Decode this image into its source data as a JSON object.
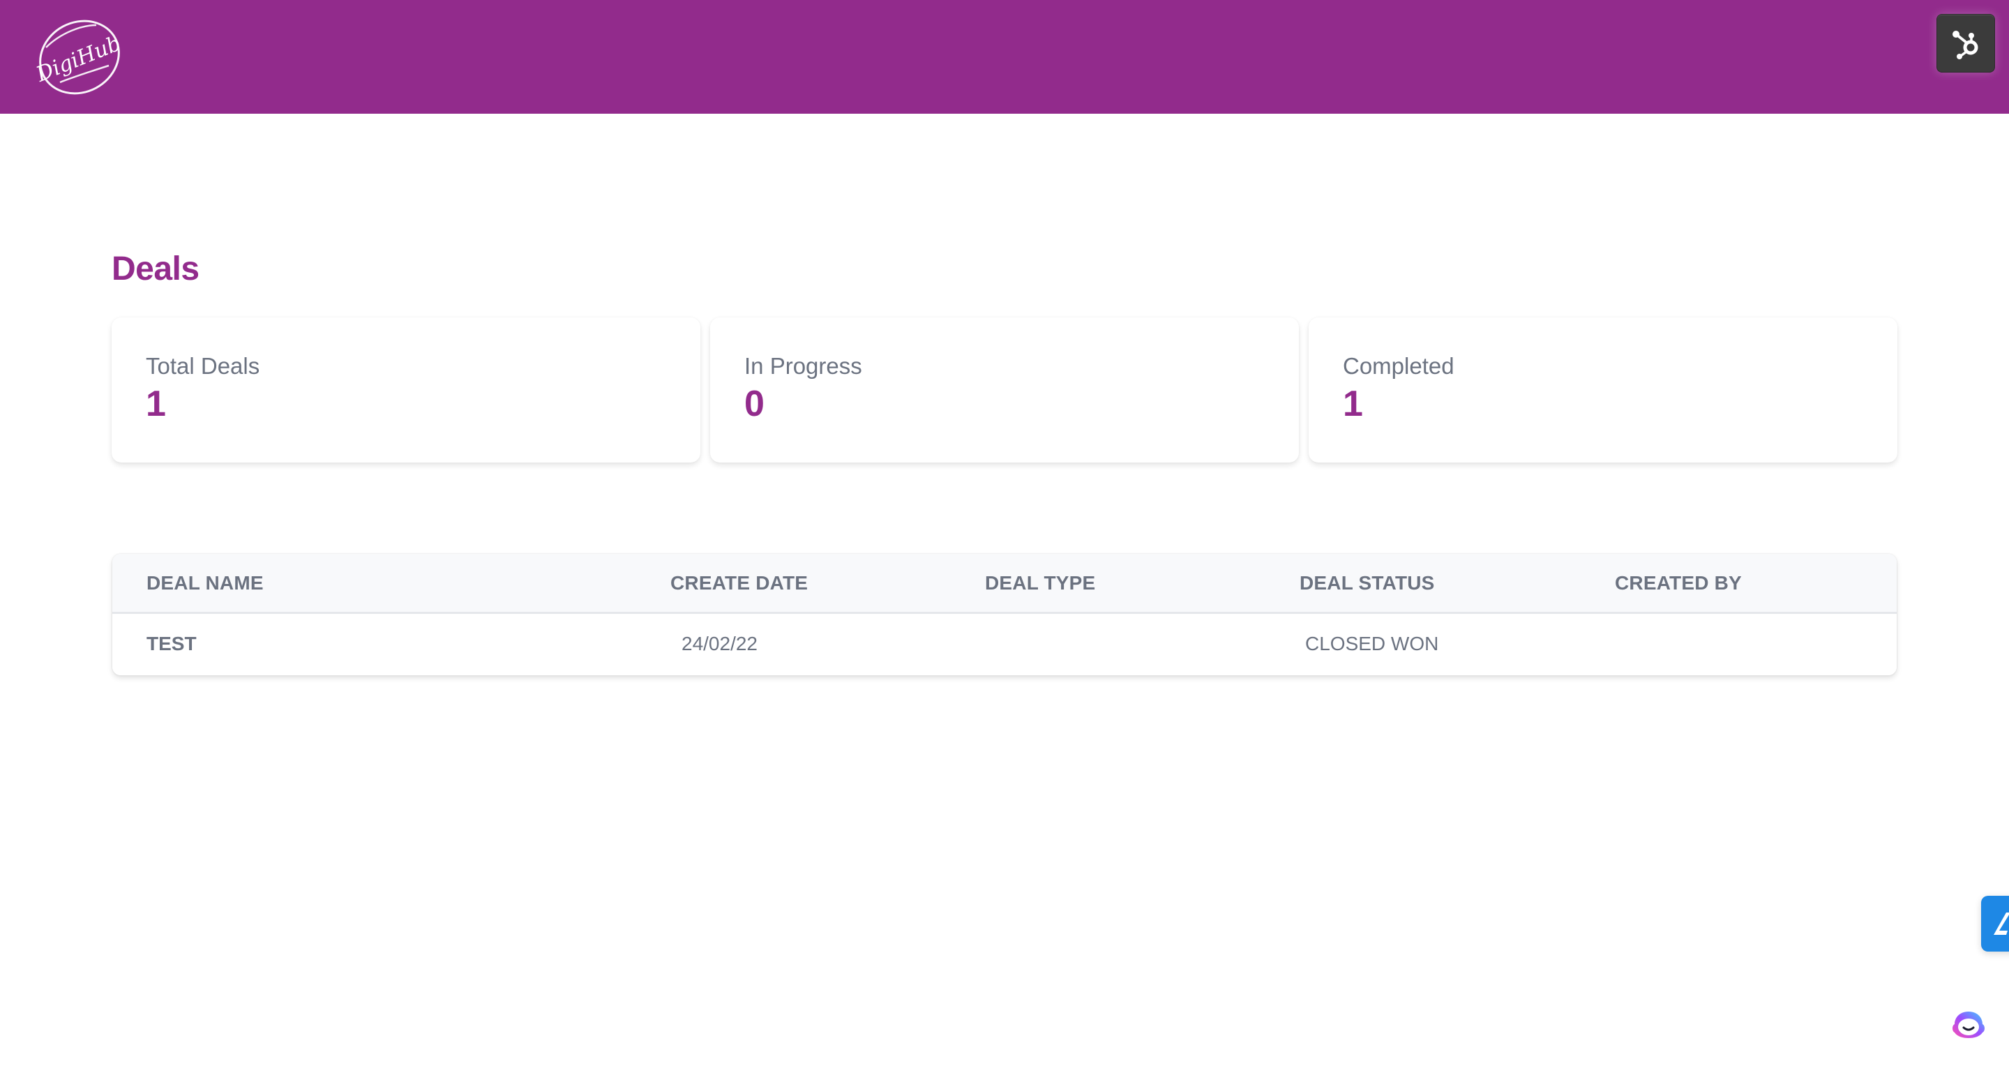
{
  "header": {
    "logo_text": "DigiHub",
    "brand_color": "#922b8c",
    "hubspot_icon": "hubspot-sprocket-icon"
  },
  "page": {
    "title": "Deals"
  },
  "stats": [
    {
      "label": "Total Deals",
      "value": "1"
    },
    {
      "label": "In Progress",
      "value": "0"
    },
    {
      "label": "Completed",
      "value": "1"
    }
  ],
  "table": {
    "columns": [
      "DEAL NAME",
      "CREATE DATE",
      "DEAL TYPE",
      "DEAL STATUS",
      "CREATED BY"
    ],
    "rows": [
      {
        "deal_name": "TEST",
        "create_date": "24/02/22",
        "deal_type": "",
        "deal_status": "CLOSED WON",
        "created_by": ""
      }
    ]
  },
  "widgets": {
    "side_widget_icon": "feedback-widget-icon",
    "side_widget_color": "#1e88e5",
    "chat_bot_icon": "chat-bot-icon"
  }
}
